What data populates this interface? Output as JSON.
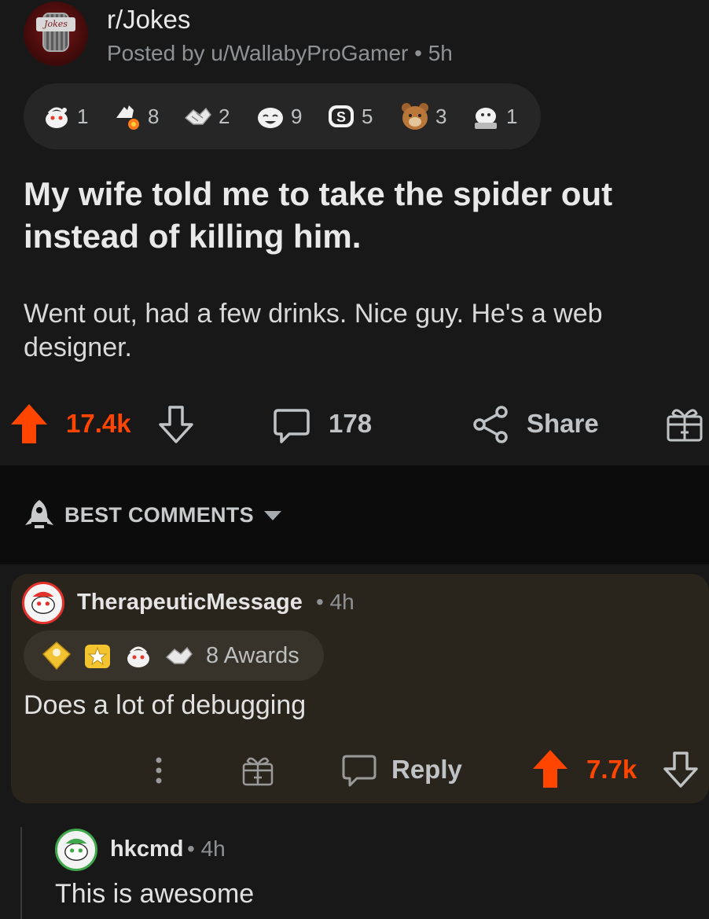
{
  "post": {
    "subreddit": "r/Jokes",
    "meta": "Posted by u/WallabyProGamer • 5h",
    "subreddit_logo_text": "Jokes",
    "awards": [
      {
        "icon": "wholesome-snoo-icon",
        "count": "1"
      },
      {
        "icon": "helpful-hand-icon",
        "count": "8"
      },
      {
        "icon": "bless-up-icon",
        "count": "2"
      },
      {
        "icon": "laughing-snoo-icon",
        "count": "9"
      },
      {
        "icon": "s-coin-icon",
        "count": "5"
      },
      {
        "icon": "bear-icon",
        "count": "3"
      },
      {
        "icon": "ally-snoo-icon",
        "count": "1"
      }
    ],
    "title": "My wife told me to take the spider out instead of killing him.",
    "body": "Went out, had a few drinks. Nice guy. He's a web designer.",
    "score": "17.4k",
    "comments": "178",
    "share_label": "Share",
    "upvote_color": "#ff4500"
  },
  "sort": {
    "label": "BEST COMMENTS"
  },
  "comment": {
    "author": "TherapeuticMessage",
    "time": "• 4h",
    "award_icons": [
      "gold-award-icon",
      "star-award-icon",
      "wholesome-snoo-icon",
      "bless-up-icon"
    ],
    "awards_label": "8 Awards",
    "text": "Does a lot of debugging",
    "reply_label": "Reply",
    "score": "7.7k"
  },
  "reply": {
    "author": "hkcmd",
    "time": "• 4h",
    "text": "This is awesome"
  }
}
